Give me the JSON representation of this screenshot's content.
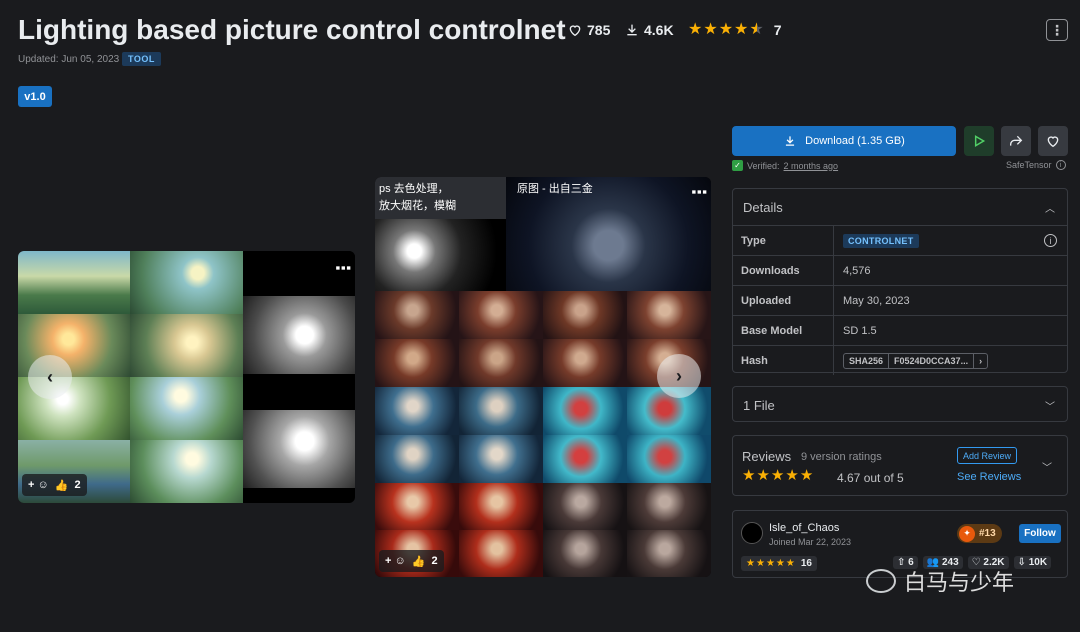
{
  "header": {
    "title": "Lighting based picture control controlnet",
    "likes": "785",
    "downloads": "4.6K",
    "rating_count": "7",
    "menu_label": "⋮",
    "updated": "Updated: Jun 05, 2023",
    "type_badge": "TOOL"
  },
  "version_tab": "v1.0",
  "gallery": {
    "prev_label": "‹",
    "next_label": "›",
    "kebab": "⋮",
    "card_a": {
      "reaction_add": "+",
      "reaction_count": "2"
    },
    "card_b": {
      "left_caption_line1": "ps 去色处理，",
      "left_caption_line2": "放大烟花，模糊",
      "right_caption": "原图 - 出自三金",
      "reaction_add": "+",
      "reaction_count": "2"
    }
  },
  "actions": {
    "download_label": "Download (1.35 GB)",
    "verified_label": "Verified:",
    "verified_link": "2 months ago",
    "safetensor_label": "SafeTensor"
  },
  "details": {
    "title": "Details",
    "rows": [
      {
        "key": "Type",
        "value": "CONTROLNET"
      },
      {
        "key": "Downloads",
        "value": "4,576"
      },
      {
        "key": "Uploaded",
        "value": "May 30, 2023"
      },
      {
        "key": "Base Model",
        "value": "SD 1.5"
      },
      {
        "key": "Hash",
        "hash_algo": "SHA256",
        "hash_value": "F0524D0CCA37..."
      }
    ]
  },
  "files": {
    "title": "1 File"
  },
  "reviews": {
    "title": "Reviews",
    "version_ratings": "9 version ratings",
    "score": "4.67 out of 5",
    "add_review": "Add Review",
    "see_reviews": "See Reviews"
  },
  "creator": {
    "name": "Isle_of_Chaos",
    "joined": "Joined Mar 22, 2023",
    "rank": "#13",
    "follow_label": "Follow",
    "rating_count": "16",
    "uploads": "6",
    "followers": "243",
    "likes": "2.2K",
    "downloads": "10K"
  },
  "watermark": {
    "text": "白马与少年"
  }
}
